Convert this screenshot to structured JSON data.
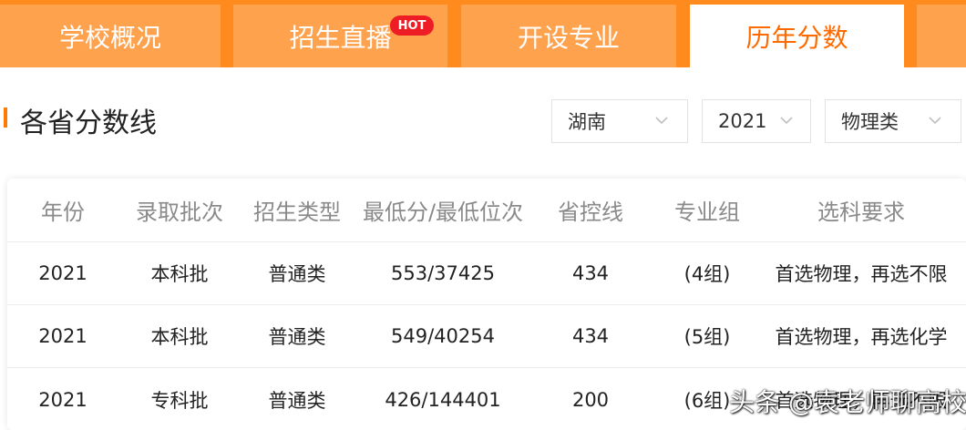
{
  "tabs": [
    {
      "label": "学校概况",
      "active": false
    },
    {
      "label": "招生直播",
      "active": false,
      "badge": "HOT"
    },
    {
      "label": "开设专业",
      "active": false
    },
    {
      "label": "历年分数",
      "active": true
    }
  ],
  "section": {
    "title": "各省分数线"
  },
  "filters": {
    "province": "湖南",
    "year": "2021",
    "category": "物理类"
  },
  "table": {
    "headers": [
      "年份",
      "录取批次",
      "招生类型",
      "最低分/最低位次",
      "省控线",
      "专业组",
      "选科要求"
    ],
    "rows": [
      [
        "2021",
        "本科批",
        "普通类",
        "553/37425",
        "434",
        "(4组)",
        "首选物理，再选不限"
      ],
      [
        "2021",
        "本科批",
        "普通类",
        "549/40254",
        "434",
        "(5组)",
        "首选物理，再选化学"
      ],
      [
        "2021",
        "专科批",
        "普通类",
        "426/144401",
        "200",
        "(6组)",
        "首选物理，再选不限"
      ]
    ]
  },
  "watermark": "头条 @袁老师聊高校",
  "colors": {
    "accent": "#ff7a00",
    "tab_bg": "#ff8a1d",
    "tab": "#ffa24e",
    "badge": "#ee1c24"
  }
}
